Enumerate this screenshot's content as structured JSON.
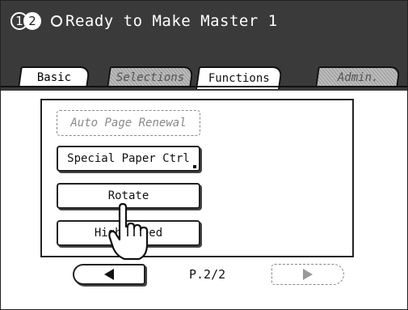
{
  "header": {
    "drum_1": "1",
    "drum_2": "2",
    "status_text": "Ready to Make Master 1"
  },
  "tabs": [
    {
      "label": "Basic",
      "state": "normal"
    },
    {
      "label": "Selections",
      "state": "disabled"
    },
    {
      "label": "Functions",
      "state": "active"
    },
    {
      "label": "Admin.",
      "state": "disabled"
    }
  ],
  "functions": [
    {
      "label": "Auto Page Renewal",
      "enabled": false
    },
    {
      "label": "Special Paper Ctrl",
      "enabled": true
    },
    {
      "label": "Rotate",
      "enabled": true
    },
    {
      "label": "High Speed",
      "enabled": true
    }
  ],
  "pagination": {
    "page": "P.2/2"
  },
  "icons": {
    "status": "circle-status-icon",
    "prev": "left-triangle-icon",
    "next": "right-triangle-icon",
    "pointer": "pointing-hand-icon"
  },
  "colors": {
    "header_bg": "#3a3a3a",
    "disabled_tab": "#bdbdbd"
  }
}
